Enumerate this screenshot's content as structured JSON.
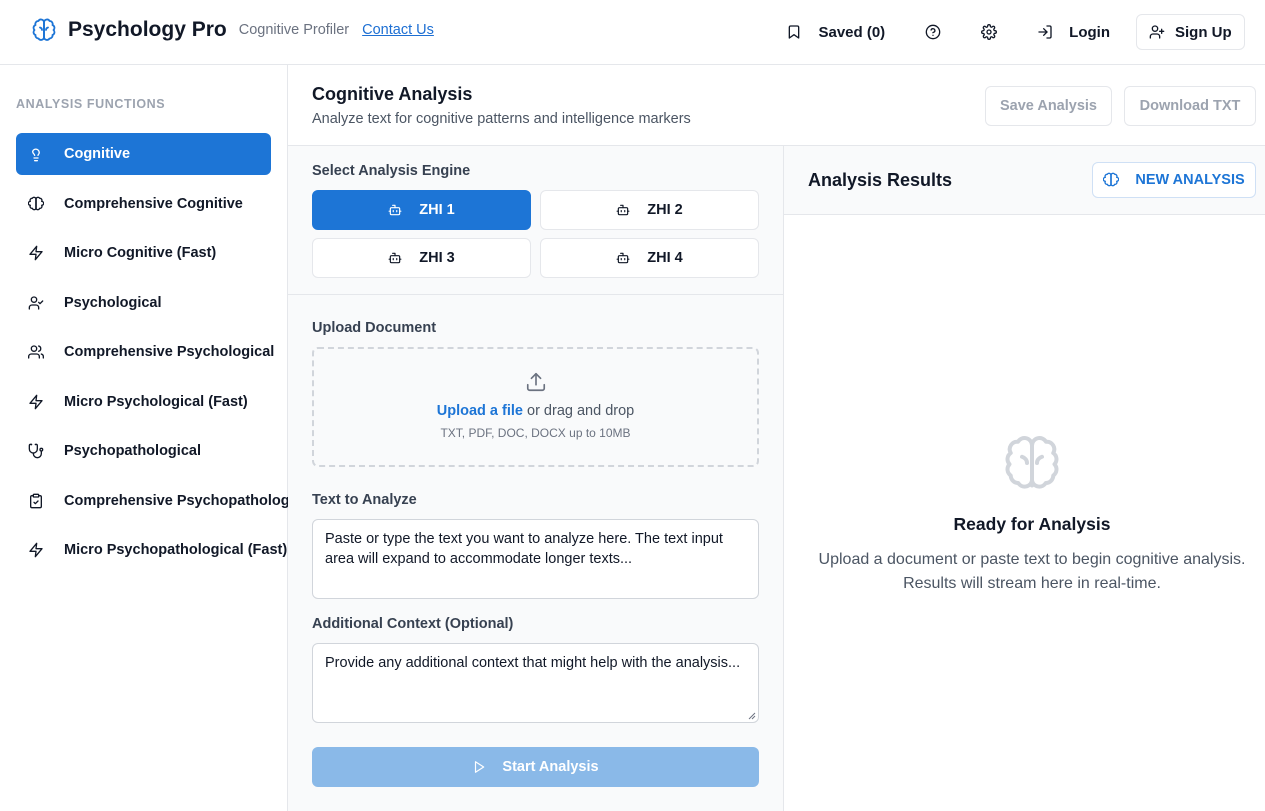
{
  "header": {
    "app_title": "Psychology Pro",
    "subtitle": "Cognitive Profiler",
    "contact_link": "Contact Us",
    "saved_label": "Saved (0)",
    "login_label": "Login",
    "signup_label": "Sign Up",
    "icons": [
      "brain-icon",
      "bookmark-icon",
      "help-circle-icon",
      "gear-icon",
      "login-icon",
      "user-plus-icon"
    ]
  },
  "sidebar": {
    "heading": "ANALYSIS FUNCTIONS",
    "items": [
      {
        "label": "Cognitive",
        "icon": "lightbulb-icon",
        "active": true
      },
      {
        "label": "Comprehensive Cognitive",
        "icon": "brain-icon",
        "active": false
      },
      {
        "label": "Micro Cognitive (Fast)",
        "icon": "zap-icon",
        "active": false
      },
      {
        "label": "Psychological",
        "icon": "user-check-icon",
        "active": false
      },
      {
        "label": "Comprehensive Psychological",
        "icon": "users-icon",
        "active": false
      },
      {
        "label": "Micro Psychological (Fast)",
        "icon": "zap-icon",
        "active": false
      },
      {
        "label": "Psychopathological",
        "icon": "stethoscope-icon",
        "active": false
      },
      {
        "label": "Comprehensive Psychopathological",
        "icon": "clipboard-icon",
        "active": false
      },
      {
        "label": "Micro Psychopathological (Fast)",
        "icon": "zap-icon",
        "active": false
      }
    ]
  },
  "main": {
    "title": "Cognitive Analysis",
    "subtitle": "Analyze text for cognitive patterns and intelligence markers",
    "save_button": "Save Analysis",
    "download_button": "Download TXT"
  },
  "engine": {
    "label": "Select Analysis Engine",
    "options": [
      {
        "label": "ZHI 1",
        "active": true
      },
      {
        "label": "ZHI 2",
        "active": false
      },
      {
        "label": "ZHI 3",
        "active": false
      },
      {
        "label": "ZHI 4",
        "active": false
      }
    ]
  },
  "upload": {
    "label": "Upload Document",
    "link_text": "Upload a file",
    "rest_text": " or drag and drop",
    "hint": "TXT, PDF, DOC, DOCX up to 10MB"
  },
  "text_input": {
    "label": "Text to Analyze",
    "placeholder": "Paste or type the text you want to analyze here. The text input area will expand to accommodate longer texts..."
  },
  "context_input": {
    "label": "Additional Context (Optional)",
    "placeholder": "Provide any additional context that might help with the analysis..."
  },
  "start_button": "Start Analysis",
  "results": {
    "title": "Analysis Results",
    "new_button": "NEW ANALYSIS",
    "empty_title": "Ready for Analysis",
    "empty_text_1": "Upload a document or paste text to begin cognitive analysis.",
    "empty_text_2": "Results will stream here in real-time."
  },
  "colors": {
    "accent": "#1d75d6",
    "start_disabled": "#8ab9e8",
    "border": "#e5e7eb"
  }
}
